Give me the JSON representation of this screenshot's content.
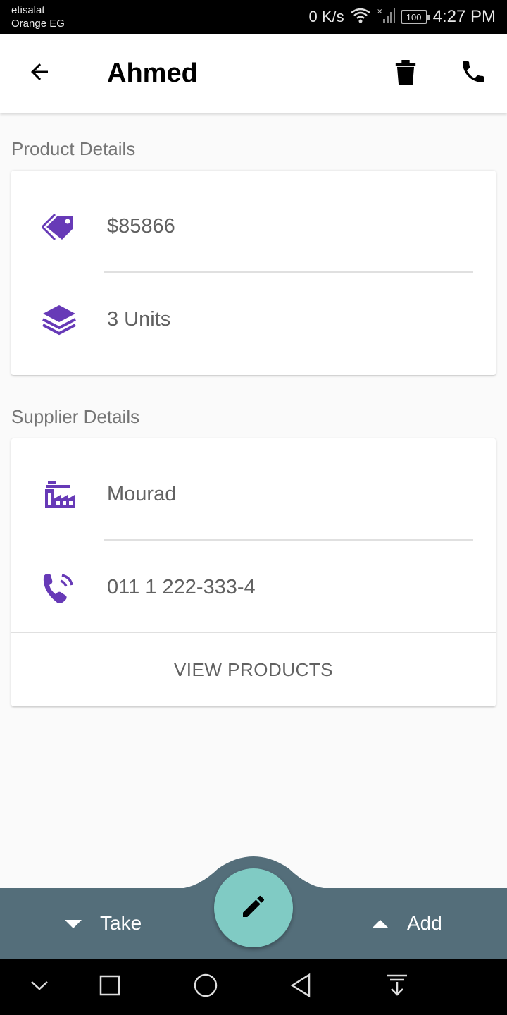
{
  "status_bar": {
    "carrier_line1": "etisalat",
    "carrier_line2": "Orange EG",
    "net_speed": "0 K/s",
    "battery": "100",
    "time": "4:27 PM"
  },
  "app_bar": {
    "title": "Ahmed",
    "back_icon": "arrow-back-icon",
    "delete_icon": "trash-icon",
    "call_icon": "phone-icon"
  },
  "product_details": {
    "label": "Product Details",
    "price": "$85866",
    "price_icon": "price-tag-icon",
    "quantity": "3 Units",
    "quantity_icon": "layers-icon"
  },
  "supplier_details": {
    "label": "Supplier Details",
    "name": "Mourad",
    "name_icon": "factory-icon",
    "phone": "011 1 222-333-4",
    "phone_icon": "phone-volume-icon",
    "view_products_label": "VIEW PRODUCTS"
  },
  "bottom_bar": {
    "take_label": "Take",
    "add_label": "Add",
    "fab_icon": "pencil-icon"
  },
  "colors": {
    "accent": "#673ab7",
    "bottom_bar": "#546e7a",
    "fab": "#80cbc4",
    "app_bar": "#ffffff"
  }
}
